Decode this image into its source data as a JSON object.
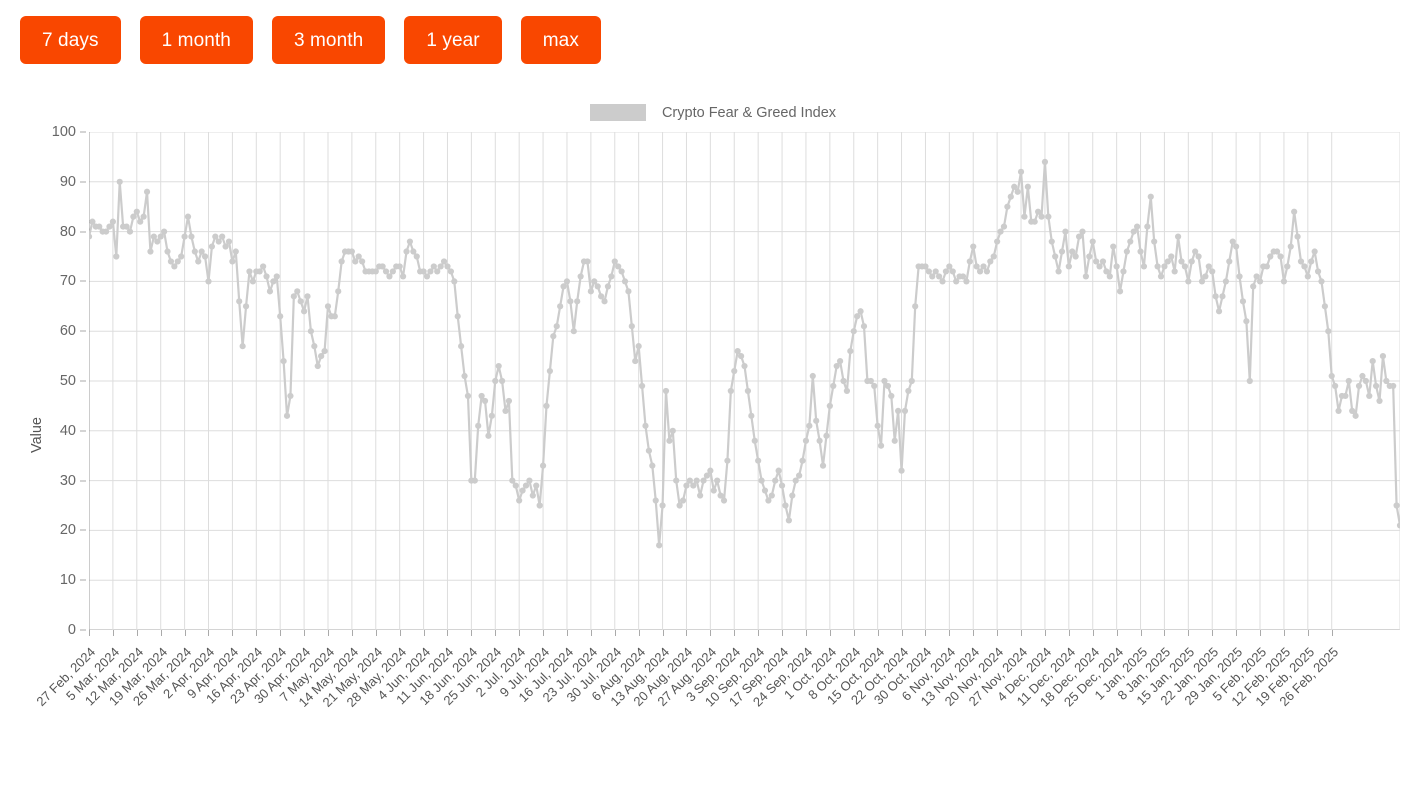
{
  "range_buttons": [
    {
      "label": "7 days",
      "name": "range-7-days"
    },
    {
      "label": "1 month",
      "name": "range-1-month"
    },
    {
      "label": "3 month",
      "name": "range-3-month"
    },
    {
      "label": "1 year",
      "name": "range-1-year"
    },
    {
      "label": "max",
      "name": "range-max"
    }
  ],
  "colors": {
    "button_bg": "#F94700",
    "button_text": "#FFFFFF",
    "series": "#CCCCCC",
    "grid": "#DDDDDD",
    "axis": "#AAAAAA",
    "tick_text": "#666666"
  },
  "legend": {
    "label": "Crypto Fear & Greed Index",
    "swatch_color": "#CCCCCC"
  },
  "chart_data": {
    "type": "line",
    "title": "",
    "subtitle": "",
    "xlabel": "",
    "ylabel": "Value",
    "ylim": [
      0,
      100
    ],
    "ytick_step": 10,
    "yticks": [
      0,
      10,
      20,
      30,
      40,
      50,
      60,
      70,
      80,
      90,
      100
    ],
    "grid": true,
    "legend_position": "top-center",
    "markers": true,
    "x_start": "27 Feb, 2024",
    "x_end": "26 Feb, 2025",
    "x_tick_interval_days": 7,
    "xticks": [
      "27 Feb, 2024",
      "5 Mar, 2024",
      "12 Mar, 2024",
      "19 Mar, 2024",
      "26 Mar, 2024",
      "2 Apr, 2024",
      "9 Apr, 2024",
      "16 Apr, 2024",
      "23 Apr, 2024",
      "30 Apr, 2024",
      "7 May, 2024",
      "14 May, 2024",
      "21 May, 2024",
      "28 May, 2024",
      "4 Jun, 2024",
      "11 Jun, 2024",
      "18 Jun, 2024",
      "25 Jun, 2024",
      "2 Jul, 2024",
      "9 Jul, 2024",
      "16 Jul, 2024",
      "23 Jul, 2024",
      "30 Jul, 2024",
      "6 Aug, 2024",
      "13 Aug, 2024",
      "20 Aug, 2024",
      "27 Aug, 2024",
      "3 Sep, 2024",
      "10 Sep, 2024",
      "17 Sep, 2024",
      "24 Sep, 2024",
      "1 Oct, 2024",
      "8 Oct, 2024",
      "15 Oct, 2024",
      "22 Oct, 2024",
      "30 Oct, 2024",
      "6 Nov, 2024",
      "13 Nov, 2024",
      "20 Nov, 2024",
      "27 Nov, 2024",
      "4 Dec, 2024",
      "11 Dec, 2024",
      "18 Dec, 2024",
      "25 Dec, 2024",
      "1 Jan, 2025",
      "8 Jan, 2025",
      "15 Jan, 2025",
      "22 Jan, 2025",
      "29 Jan, 2025",
      "5 Feb, 2025",
      "12 Feb, 2025",
      "19 Feb, 2025",
      "26 Feb, 2025"
    ],
    "series": [
      {
        "name": "Crypto Fear & Greed Index",
        "color": "#CCCCCC",
        "values": [
          79,
          82,
          81,
          81,
          80,
          80,
          81,
          82,
          75,
          90,
          81,
          81,
          80,
          83,
          84,
          82,
          83,
          88,
          76,
          79,
          78,
          79,
          80,
          76,
          74,
          73,
          74,
          75,
          79,
          83,
          79,
          76,
          74,
          76,
          75,
          70,
          77,
          79,
          78,
          79,
          77,
          78,
          74,
          76,
          66,
          57,
          65,
          72,
          70,
          72,
          72,
          73,
          71,
          68,
          70,
          71,
          63,
          54,
          43,
          47,
          67,
          68,
          66,
          64,
          67,
          60,
          57,
          53,
          55,
          56,
          65,
          63,
          63,
          68,
          74,
          76,
          76,
          76,
          74,
          75,
          74,
          72,
          72,
          72,
          72,
          73,
          73,
          72,
          71,
          72,
          73,
          73,
          71,
          76,
          78,
          76,
          75,
          72,
          72,
          71,
          72,
          73,
          72,
          73,
          74,
          73,
          72,
          70,
          63,
          57,
          51,
          47,
          30,
          30,
          41,
          47,
          46,
          39,
          43,
          50,
          53,
          50,
          44,
          46,
          30,
          29,
          26,
          28,
          29,
          30,
          27,
          29,
          25,
          33,
          45,
          52,
          59,
          61,
          65,
          69,
          70,
          66,
          60,
          66,
          71,
          74,
          74,
          68,
          70,
          69,
          67,
          66,
          69,
          71,
          74,
          73,
          72,
          70,
          68,
          61,
          54,
          57,
          49,
          41,
          36,
          33,
          26,
          17,
          25,
          48,
          38,
          40,
          30,
          25,
          26,
          29,
          30,
          29,
          30,
          27,
          30,
          31,
          32,
          28,
          30,
          27,
          26,
          34,
          48,
          52,
          56,
          55,
          53,
          48,
          43,
          38,
          34,
          30,
          28,
          26,
          27,
          30,
          32,
          29,
          25,
          22,
          27,
          30,
          31,
          34,
          38,
          41,
          51,
          42,
          38,
          33,
          39,
          45,
          49,
          53,
          54,
          50,
          48,
          56,
          60,
          63,
          64,
          61,
          50,
          50,
          49,
          41,
          37,
          50,
          49,
          47,
          38,
          44,
          32,
          44,
          48,
          50,
          65,
          73,
          73,
          73,
          72,
          71,
          72,
          71,
          70,
          72,
          73,
          72,
          70,
          71,
          71,
          70,
          74,
          77,
          73,
          72,
          73,
          72,
          74,
          75,
          78,
          80,
          81,
          85,
          87,
          89,
          88,
          92,
          83,
          89,
          82,
          82,
          84,
          83,
          94,
          83,
          78,
          75,
          72,
          76,
          80,
          73,
          76,
          75,
          79,
          80,
          71,
          75,
          78,
          74,
          73,
          74,
          72,
          71,
          77,
          73,
          68,
          72,
          76,
          78,
          80,
          81,
          76,
          73,
          81,
          87,
          78,
          73,
          71,
          73,
          74,
          75,
          72,
          79,
          74,
          73,
          70,
          74,
          76,
          75,
          70,
          71,
          73,
          72,
          67,
          64,
          67,
          70,
          74,
          78,
          77,
          71,
          66,
          62,
          50,
          69,
          71,
          70,
          73,
          73,
          75,
          76,
          76,
          75,
          70,
          73,
          77,
          84,
          79,
          74,
          73,
          71,
          74,
          76,
          72,
          70,
          65,
          60,
          51,
          49,
          44,
          47,
          47,
          50,
          44,
          43,
          49,
          51,
          50,
          47,
          54,
          49,
          46,
          55,
          50,
          49,
          49,
          25,
          21
        ]
      }
    ]
  }
}
